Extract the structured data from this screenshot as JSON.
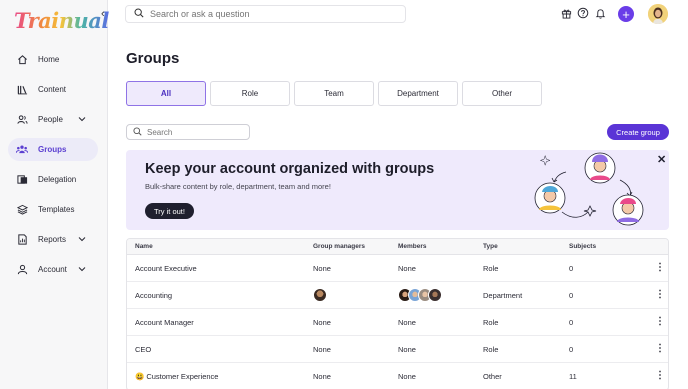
{
  "app": {
    "logo_text": "Trainual"
  },
  "topbar": {
    "search_placeholder": "Search or ask a question",
    "icons": [
      "gift-icon",
      "help-icon",
      "bell-icon"
    ],
    "plus_label": "+"
  },
  "sidebar": {
    "items": [
      {
        "label": "Home",
        "icon": "home-icon",
        "active": false,
        "expandable": false
      },
      {
        "label": "Content",
        "icon": "books-icon",
        "active": false,
        "expandable": false
      },
      {
        "label": "People",
        "icon": "people-icon",
        "active": false,
        "expandable": true
      },
      {
        "label": "Groups",
        "icon": "groups-icon",
        "active": true,
        "expandable": false
      },
      {
        "label": "Delegation",
        "icon": "delegation-icon",
        "active": false,
        "expandable": false
      },
      {
        "label": "Templates",
        "icon": "layers-icon",
        "active": false,
        "expandable": false
      },
      {
        "label": "Reports",
        "icon": "report-icon",
        "active": false,
        "expandable": true
      },
      {
        "label": "Account",
        "icon": "account-icon",
        "active": false,
        "expandable": true
      }
    ]
  },
  "main": {
    "title": "Groups",
    "tabs": [
      {
        "label": "All",
        "active": true
      },
      {
        "label": "Role",
        "active": false
      },
      {
        "label": "Team",
        "active": false
      },
      {
        "label": "Department",
        "active": false
      },
      {
        "label": "Other",
        "active": false
      }
    ],
    "search_placeholder": "Search",
    "create_button": "Create group"
  },
  "banner": {
    "title": "Keep your account organized with groups",
    "subtitle": "Bulk-share content by role, department, team and more!",
    "button": "Try it out!",
    "close": "✕"
  },
  "table": {
    "headers": {
      "name": "Name",
      "managers": "Group managers",
      "members": "Members",
      "type": "Type",
      "subjects": "Subjects"
    },
    "rows": [
      {
        "name": "Account Executive",
        "managers": "None",
        "members": "None",
        "type": "Role",
        "subjects": "0",
        "emoji": ""
      },
      {
        "name": "Accounting",
        "managers": "",
        "members": "",
        "type": "Department",
        "subjects": "0",
        "emoji": ""
      },
      {
        "name": "Account Manager",
        "managers": "None",
        "members": "None",
        "type": "Role",
        "subjects": "0",
        "emoji": ""
      },
      {
        "name": "CEO",
        "managers": "None",
        "members": "None",
        "type": "Role",
        "subjects": "0",
        "emoji": ""
      },
      {
        "name": "Customer Experience",
        "managers": "None",
        "members": "None",
        "type": "Other",
        "subjects": "11",
        "emoji": "😃"
      }
    ]
  },
  "colors": {
    "accent": "#5a34d6",
    "banner_bg": "#efeafc",
    "active_nav_bg": "#ecebf8"
  }
}
